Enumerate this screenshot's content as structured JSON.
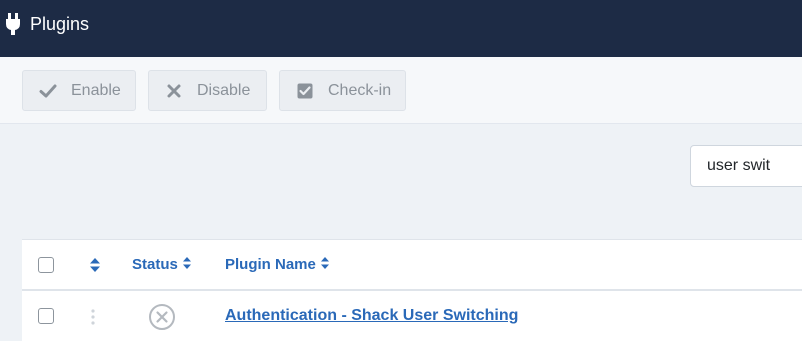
{
  "header": {
    "title": "Plugins",
    "icon": "plug-icon"
  },
  "toolbar": {
    "enable_label": "Enable",
    "disable_label": "Disable",
    "checkin_label": "Check-in"
  },
  "search": {
    "value": "user swit"
  },
  "table": {
    "columns": {
      "status": "Status",
      "plugin_name": "Plugin Name"
    },
    "rows": [
      {
        "name": "Authentication - Shack User Switching",
        "status": "disabled",
        "selected": false
      }
    ]
  },
  "colors": {
    "header_bg": "#1d2b45",
    "link": "#2a69b8",
    "page_bg": "#eef2f6"
  }
}
